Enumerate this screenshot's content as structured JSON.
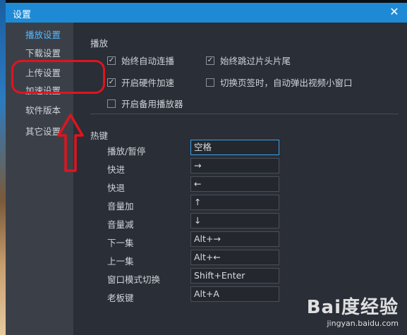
{
  "window": {
    "title": "设置",
    "close_glyph": "✕"
  },
  "sidebar": {
    "items": [
      {
        "label": "播放设置",
        "active": true
      },
      {
        "label": "下载设置",
        "active": false
      },
      {
        "label": "上传设置",
        "active": false
      },
      {
        "label": "加速设置",
        "active": false
      },
      {
        "label": "软件版本",
        "active": false
      },
      {
        "label": "其它设置",
        "active": false
      }
    ]
  },
  "playback": {
    "title": "播放",
    "options": [
      {
        "label": "始终自动连播",
        "checked": true
      },
      {
        "label": "始终跳过片头片尾",
        "checked": true
      },
      {
        "label": "开启硬件加速",
        "checked": true
      },
      {
        "label": "切换页签时，自动弹出视频小窗口",
        "checked": false
      },
      {
        "label": "开启备用播放器",
        "checked": false
      }
    ]
  },
  "hotkeys": {
    "title": "热键",
    "rows": [
      {
        "label": "播放/暂停",
        "value": "空格"
      },
      {
        "label": "快进",
        "value": "→"
      },
      {
        "label": "快退",
        "value": "←"
      },
      {
        "label": "音量加",
        "value": "↑"
      },
      {
        "label": "音量减",
        "value": "↓"
      },
      {
        "label": "下一集",
        "value": "Alt+→"
      },
      {
        "label": "上一集",
        "value": "Alt+←"
      },
      {
        "label": "窗口模式切换",
        "value": "Shift+Enter"
      },
      {
        "label": "老板键",
        "value": "Alt+A"
      }
    ]
  },
  "check_glyph": "✓",
  "watermark": {
    "main": "Bai度经验",
    "sub": "jingyan.baidu.com"
  },
  "colors": {
    "titlebar": "#1e8ad6",
    "active": "#55b8ff",
    "annotation": "#e0141e"
  }
}
